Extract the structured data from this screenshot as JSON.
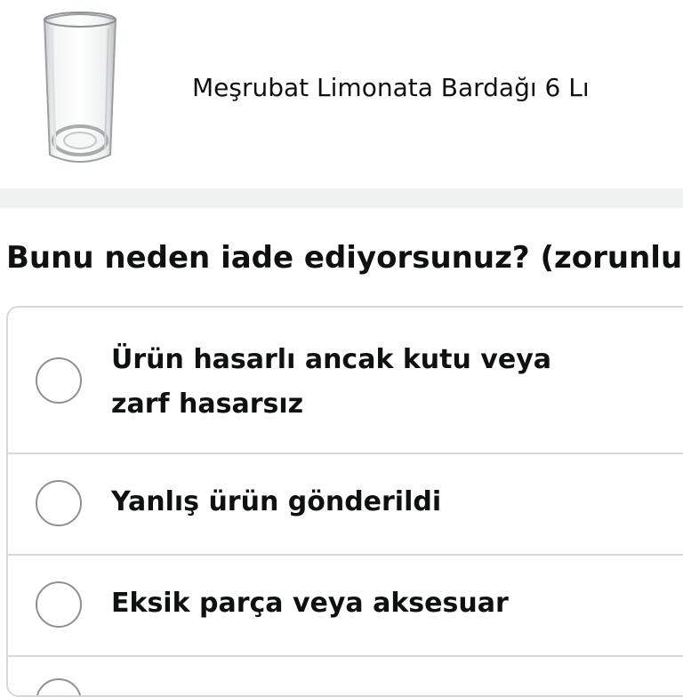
{
  "product": {
    "title": "Meşrubat Limonata Bardağı 6 Lı",
    "image_icon": "glass-icon"
  },
  "return_reason": {
    "question": "Bunu neden iade ediyorsunuz? (zorunlu)",
    "options": [
      {
        "label": "Ürün hasarlı ancak kutu veya zarf hasarsız",
        "selected": false
      },
      {
        "label": "Yanlış ürün gönderildi",
        "selected": false
      },
      {
        "label": "Eksik parça veya aksesuar",
        "selected": false
      },
      {
        "label": "",
        "selected": false
      }
    ]
  },
  "colors": {
    "text": "#0f1111",
    "border": "#d5d9d9",
    "divider": "#f0f2f2",
    "radio_border": "#8d9096"
  }
}
